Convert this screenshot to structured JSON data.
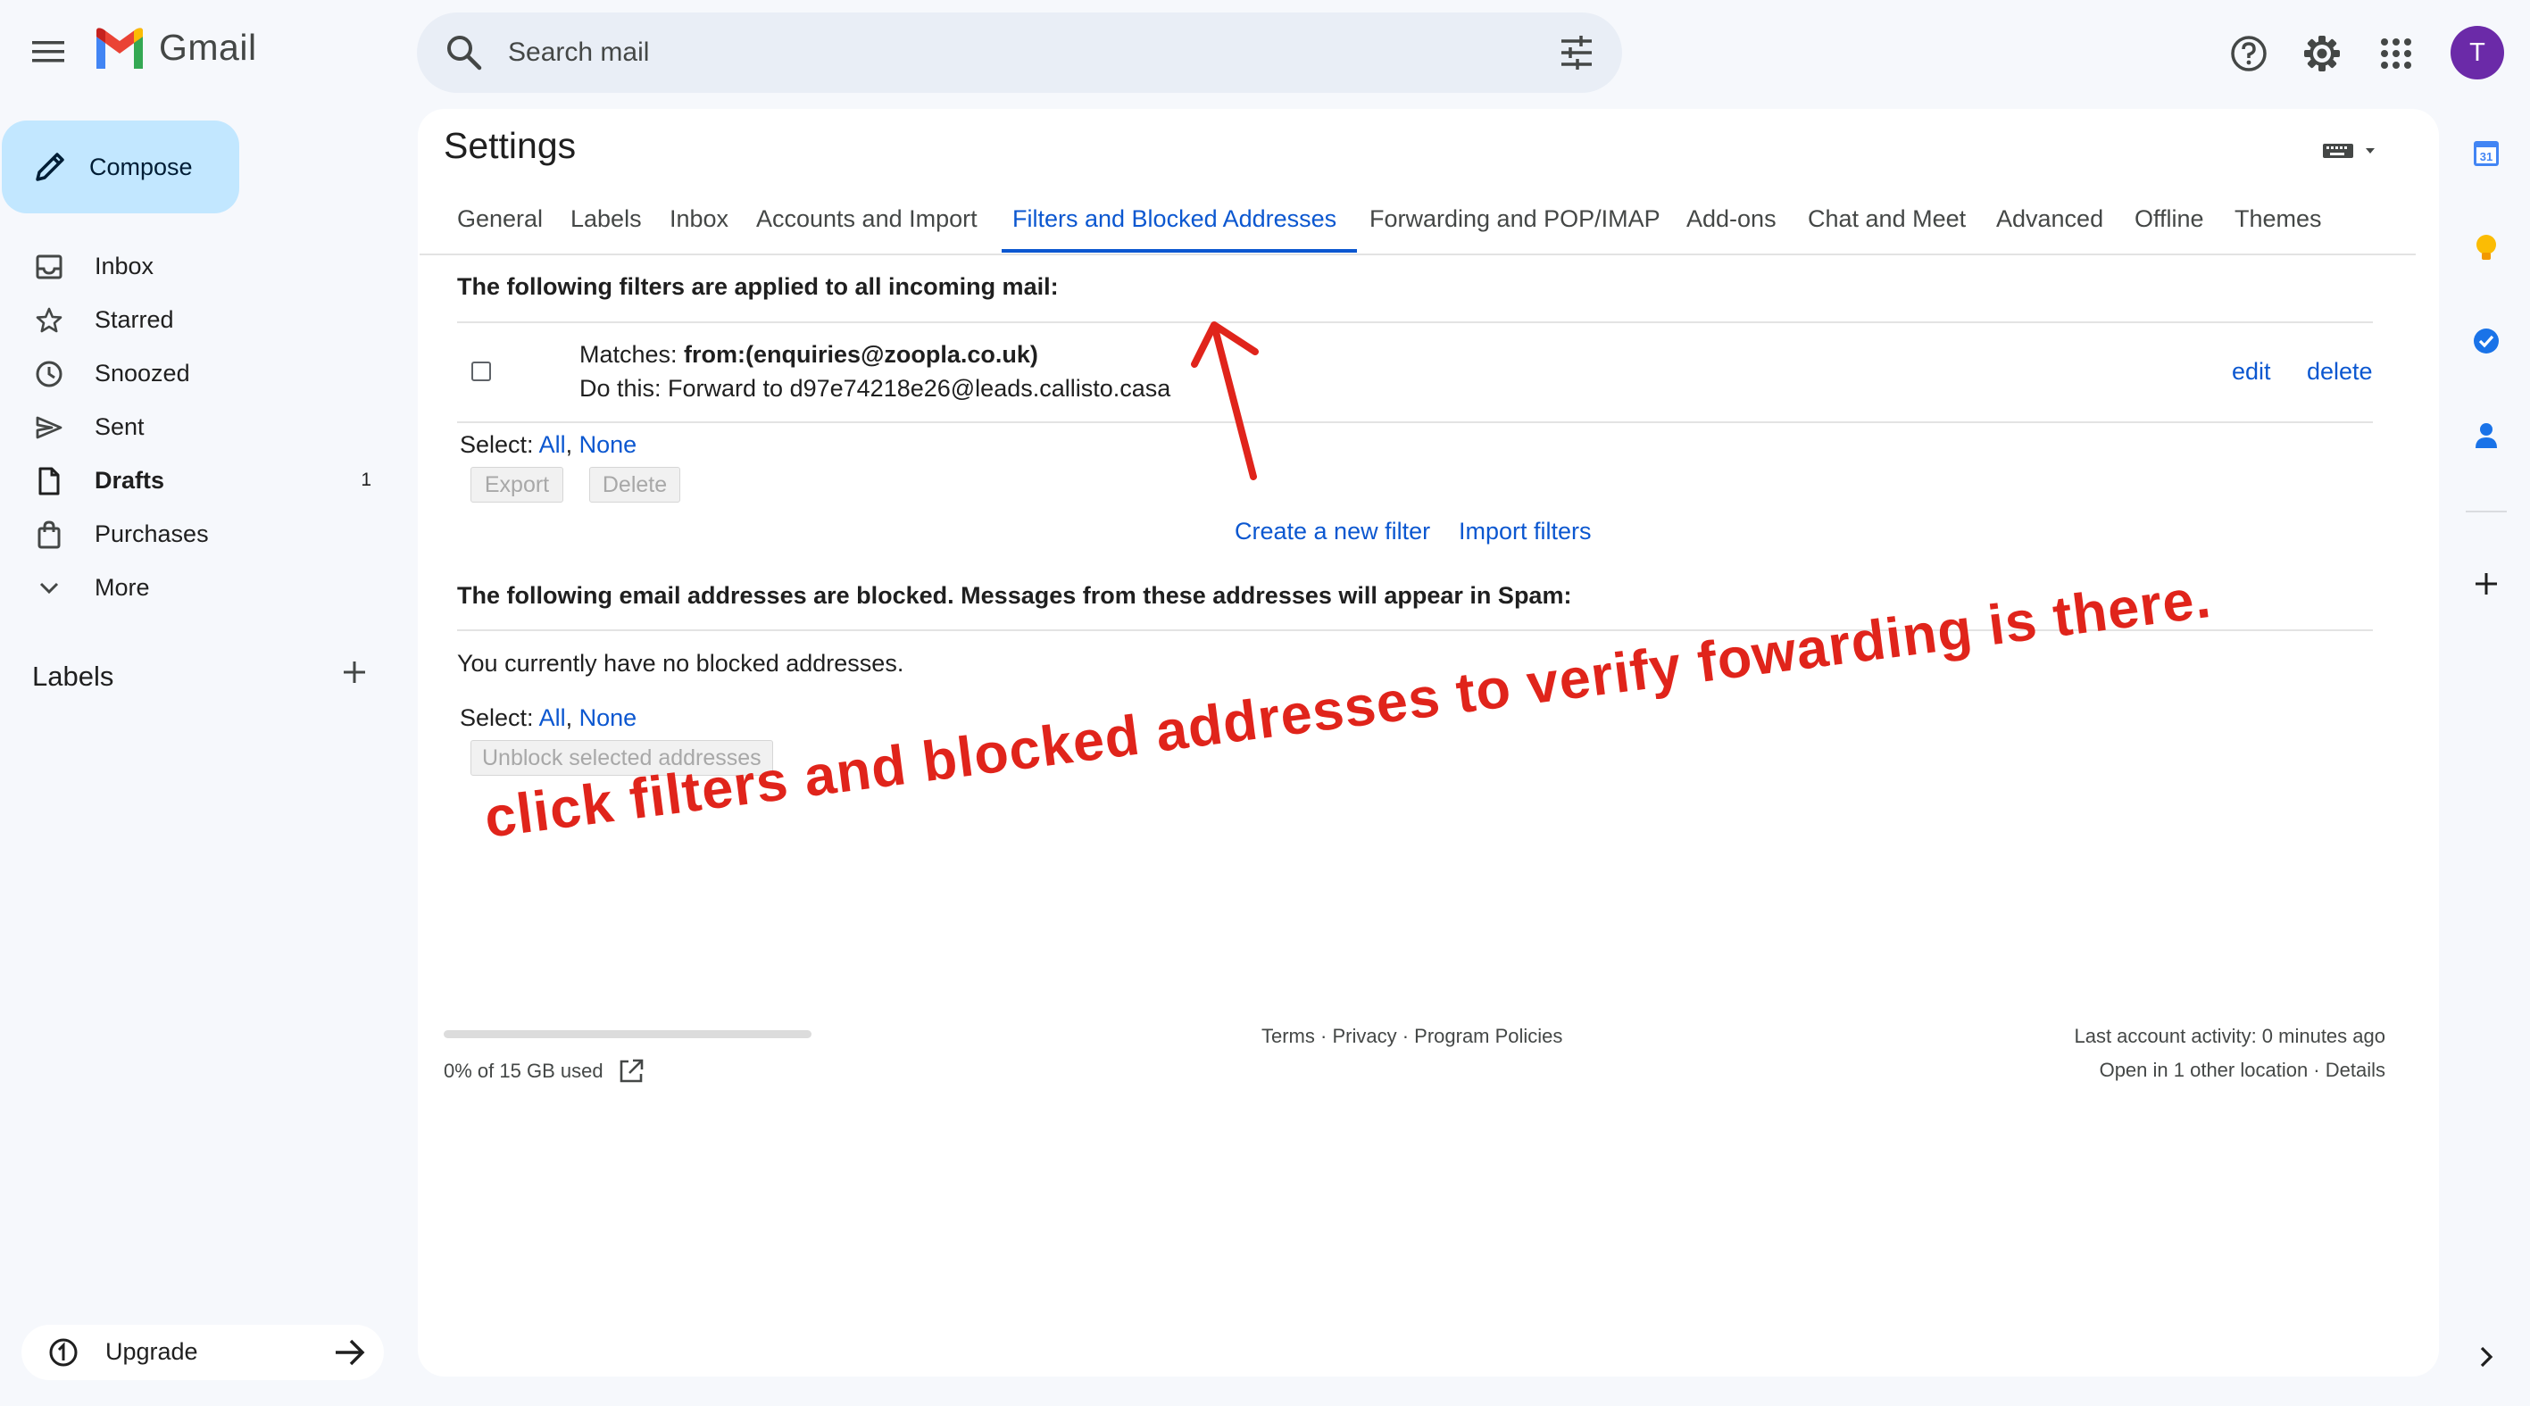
{
  "header": {
    "app_name": "Gmail",
    "search_placeholder": "Search mail",
    "avatar_initial": "T",
    "brand_colors": {
      "red": "#ea4335",
      "blue": "#4285f4",
      "green": "#34a853",
      "yellow": "#fbbc04"
    }
  },
  "sidebar": {
    "compose_label": "Compose",
    "items": [
      {
        "label": "Inbox",
        "icon": "inbox-icon",
        "count": ""
      },
      {
        "label": "Starred",
        "icon": "star-icon",
        "count": ""
      },
      {
        "label": "Snoozed",
        "icon": "clock-icon",
        "count": ""
      },
      {
        "label": "Sent",
        "icon": "send-icon",
        "count": ""
      },
      {
        "label": "Drafts",
        "icon": "draft-icon",
        "count": "1"
      },
      {
        "label": "Purchases",
        "icon": "shopping-bag-icon",
        "count": ""
      },
      {
        "label": "More",
        "icon": "chevron-down-icon",
        "count": ""
      }
    ],
    "labels_heading": "Labels",
    "upgrade_label": "Upgrade"
  },
  "settings": {
    "title": "Settings",
    "tabs": [
      {
        "label": "General"
      },
      {
        "label": "Labels"
      },
      {
        "label": "Inbox"
      },
      {
        "label": "Accounts and Import"
      },
      {
        "label": "Filters and Blocked Addresses",
        "active": true
      },
      {
        "label": "Forwarding and POP/IMAP"
      },
      {
        "label": "Add-ons"
      },
      {
        "label": "Chat and Meet"
      },
      {
        "label": "Advanced"
      },
      {
        "label": "Offline"
      },
      {
        "label": "Themes"
      }
    ],
    "filters_heading": "The following filters are applied to all incoming mail:",
    "filter": {
      "matches_prefix": "Matches: ",
      "matches_value": "from:(enquiries@zoopla.co.uk)",
      "action": "Do this: Forward to d97e74218e26@leads.callisto.casa",
      "edit_label": "edit",
      "delete_label": "delete"
    },
    "select_label": "Select: ",
    "select_all": "All",
    "comma": ",",
    "select_none": "None",
    "export_label": "Export",
    "delete_button_label": "Delete",
    "create_filter_label": "Create a new filter",
    "import_filters_label": "Import filters",
    "blocked_heading": "The following email addresses are blocked. Messages from these addresses will appear in Spam:",
    "no_blocked": "You currently have no blocked addresses.",
    "unblock_label": "Unblock selected addresses"
  },
  "footer": {
    "storage": "0% of 15 GB used",
    "storage_fraction": 0.0,
    "terms": "Terms",
    "privacy": "Privacy",
    "policies": "Program Policies",
    "sep": " · ",
    "last_activity": "Last account activity: 0 minutes ago",
    "other_location": "Open in 1 other location",
    "details": "Details"
  },
  "annotation": {
    "text": "click filters and blocked addresses to verify fowarding is there.",
    "color": "#e0241b"
  }
}
